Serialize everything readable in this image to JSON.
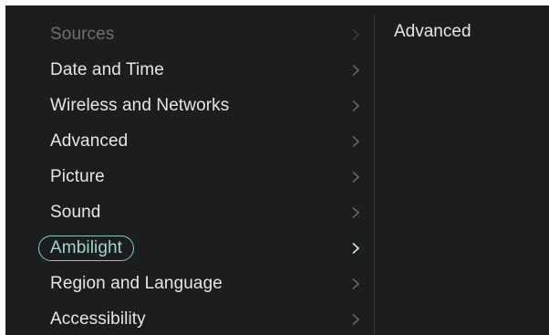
{
  "menu": {
    "items": [
      {
        "label": "Sources",
        "state": "dimmed"
      },
      {
        "label": "Date and Time",
        "state": "normal"
      },
      {
        "label": "Wireless and Networks",
        "state": "normal"
      },
      {
        "label": "Advanced",
        "state": "normal"
      },
      {
        "label": "Picture",
        "state": "normal"
      },
      {
        "label": "Sound",
        "state": "normal"
      },
      {
        "label": "Ambilight",
        "state": "selected"
      },
      {
        "label": "Region and Language",
        "state": "normal"
      },
      {
        "label": "Accessibility",
        "state": "normal"
      }
    ],
    "chevron_icon": "chevron-right-icon"
  },
  "detail": {
    "title": "Advanced"
  },
  "colors": {
    "background": "#1c1d1e",
    "text": "#e6e6e6",
    "dimmed_text": "#6e6f71",
    "highlight": "#8bc7c2",
    "chevron": "#6a6b6d",
    "chevron_active": "#cfe9e6",
    "divider": "#333436"
  }
}
